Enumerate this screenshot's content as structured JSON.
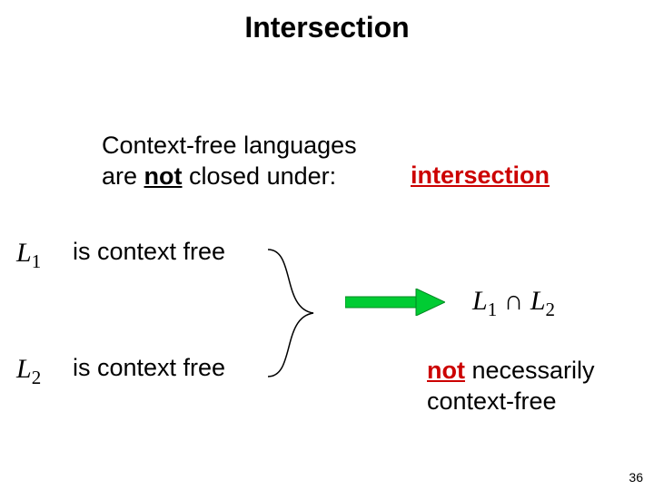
{
  "title": "Intersection",
  "statement_line1": "Context-free languages",
  "statement_line2a": "are ",
  "statement_not": "not",
  "statement_line2b": " closed under:",
  "operation": "intersection",
  "L1": "L",
  "L1_sub": "1",
  "L2": "L",
  "L2_sub": "2",
  "cf_text": "is context free",
  "intersection_expr_a": "L",
  "intersection_sub1": "1",
  "cap": " ∩ ",
  "intersection_expr_b": "L",
  "intersection_sub2": "2",
  "concl_not": "not",
  "concl_rest1": " necessarily",
  "concl_rest2": "context-free",
  "page": "36"
}
